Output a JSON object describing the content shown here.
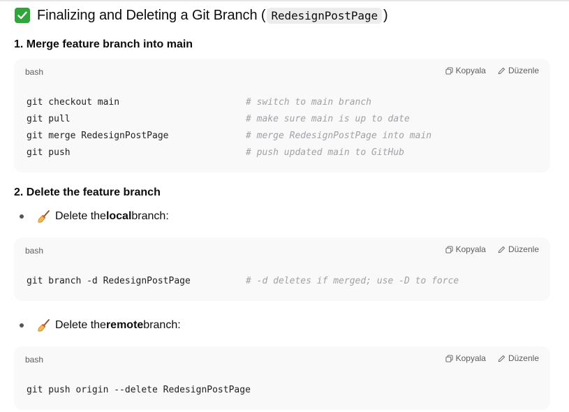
{
  "heading": {
    "title": "Finalizing and Deleting a Git Branch (",
    "branch_code": "RedesignPostPage",
    "close_paren": ")",
    "icon": "check-mark-button-icon"
  },
  "section1": {
    "title": "1. Merge feature branch into main",
    "code_block": {
      "lang": "bash",
      "copy_label": "Kopyala",
      "edit_label": "Düzenle",
      "lines": [
        {
          "code": "git checkout main",
          "comment": "# switch to main branch"
        },
        {
          "code": "git pull",
          "comment": "# make sure main is up to date"
        },
        {
          "code": "git merge RedesignPostPage",
          "comment": "# merge RedesignPostPage into main"
        },
        {
          "code": "git push",
          "comment": "# push updated main to GitHub"
        }
      ]
    }
  },
  "section2": {
    "title": "2. Delete the feature branch",
    "local": {
      "pre": "Delete the ",
      "bold": "local",
      "post": " branch:",
      "icon": "broom-icon",
      "code_block": {
        "lang": "bash",
        "copy_label": "Kopyala",
        "edit_label": "Düzenle",
        "lines": [
          {
            "code": "git branch -d RedesignPostPage",
            "comment": "# -d deletes if merged; use -D to force"
          }
        ]
      }
    },
    "remote": {
      "pre": "Delete the ",
      "bold": "remote",
      "post": " branch:",
      "icon": "broom-icon",
      "code_block": {
        "lang": "bash",
        "copy_label": "Kopyala",
        "edit_label": "Düzenle",
        "lines": [
          {
            "code": "git push origin --delete RedesignPostPage",
            "comment": ""
          }
        ]
      }
    }
  }
}
